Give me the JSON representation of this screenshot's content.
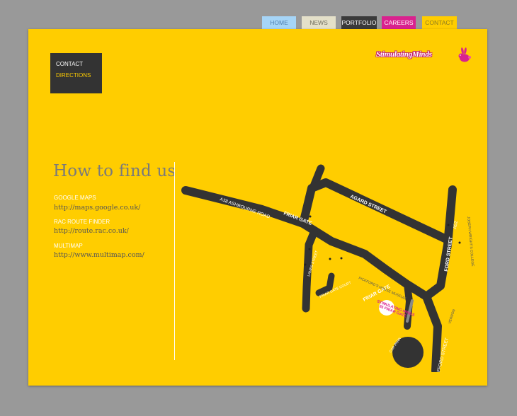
{
  "nav": {
    "tabs": [
      {
        "label": "HOME"
      },
      {
        "label": "NEWS"
      },
      {
        "label": "PORTFOLIO"
      },
      {
        "label": "CAREERS"
      },
      {
        "label": "CONTACT"
      }
    ]
  },
  "subnav": {
    "items": [
      {
        "label": "CONTACT"
      },
      {
        "label": "DIRECTIONS"
      }
    ]
  },
  "logo": {
    "text": "StimulatingMinds"
  },
  "main": {
    "title": "How to find us",
    "links": [
      {
        "label": "GOOGLE MAPS",
        "url": "http://maps.google.co.uk/"
      },
      {
        "label": "RAC ROUTE FINDER",
        "url": "http://route.rac.co.uk/"
      },
      {
        "label": "MULTIMAP",
        "url": "http://www.multimap.com/"
      }
    ]
  },
  "map": {
    "roads": {
      "a38": "A38 ASHBOURNE ROAD",
      "friar_gate_1": "FRIAR GATE",
      "friar_gate_2": "FRIAR GATE",
      "agard": "AGARD STREET",
      "ford": "FORD STREET",
      "a52": "A52",
      "joseph_wright": "JOSEPH WRIGHT'S COLLEGE",
      "lambs": "LAMBS STREET",
      "friar_gate_court": "FRIAR GATE COURT",
      "pickfords": "PICKFORD'S HOUSE MUSEUM",
      "stafford": "STAFFORD STREET",
      "vernon": "VERNON",
      "car_park": "CAR PARK"
    },
    "marker": {
      "line1": "STIMULATING MINDS",
      "line2": "36 FRIAR GATE"
    }
  },
  "colors": {
    "background": "#999999",
    "panel": "#ffcd00",
    "road": "#333333",
    "marker_text": "#d9228e",
    "home_tab": "#a6d5f7",
    "news_tab": "#e4e0c9",
    "portfolio_tab": "#3a3a3a",
    "careers_tab": "#d9228e",
    "contact_tab": "#ffcd00"
  }
}
